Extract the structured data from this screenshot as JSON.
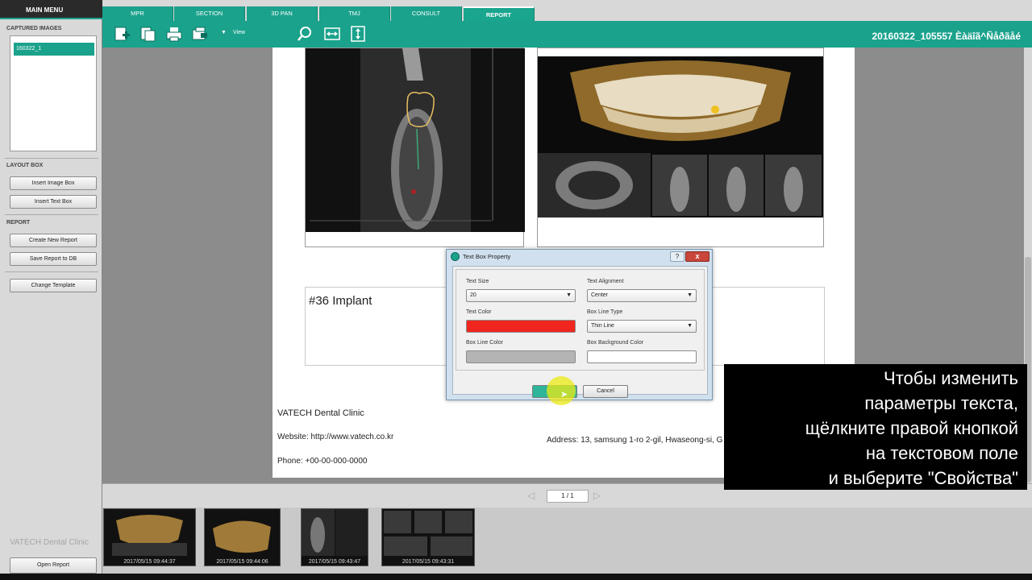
{
  "sidebar": {
    "main_menu": "MAIN MENU",
    "captured_title": "CAPTURED IMAGES",
    "captured_items": [
      "160322_1"
    ],
    "layout_title": "LAYOUT BOX",
    "insert_image_box": "Insert Image Box",
    "insert_text_box": "Insert Text Box",
    "report_title": "REPORT",
    "create_new_report": "Create New Report",
    "save_report": "Save Report to DB",
    "change_template": "Change Template",
    "watermark": "VATECH Dental Clinic",
    "open_report": "Open Report"
  },
  "tabs": [
    {
      "label": "MPR"
    },
    {
      "label": "SECTION"
    },
    {
      "label": "3D PAN"
    },
    {
      "label": "TMJ"
    },
    {
      "label": "CONSULT"
    },
    {
      "label": "REPORT"
    }
  ],
  "toolbar": {
    "view_label": "View",
    "study_title": "20160322_105557 Èàäîã^Ñåðãåé",
    "icons": [
      "add-page-icon",
      "copy-page-icon",
      "print-icon",
      "export-icon",
      "zoom-icon",
      "fit-width-icon",
      "fit-height-icon"
    ]
  },
  "report": {
    "textbox_text": "#36 Implant",
    "clinic_name": "VATECH Dental Clinic",
    "clinic_website": "Website: http://www.vatech.co.kr",
    "clinic_phone": "Phone: +00-00-000-0000",
    "clinic_address": "Address: 13, samsung 1-ro 2-gil, Hwaseong-si, G"
  },
  "dialog": {
    "title": "Text Box Property",
    "help": "?",
    "close": "x",
    "text_size_label": "Text Size",
    "text_size_value": "20",
    "text_alignment_label": "Text Alignment",
    "text_alignment_value": "Center",
    "text_color_label": "Text Color",
    "text_color": "#f0261e",
    "box_line_type_label": "Box Line Type",
    "box_line_type_value": "Thin Line",
    "box_line_color_label": "Box Line Color",
    "box_line_color": "#b4b4b4",
    "box_bg_color_label": "Box Background Color",
    "box_bg_color": "#ffffff",
    "ok_label": "OK",
    "cancel_label": "Cancel"
  },
  "pager": {
    "value": "1 / 1"
  },
  "thumbnails": [
    {
      "label": "2017/05/15 09:44:37"
    },
    {
      "label": "2017/05/15 09:44:06"
    },
    {
      "label": "2017/05/15 09:43:47"
    },
    {
      "label": "2017/05/15 09:43:31"
    }
  ],
  "subtitle": {
    "lines": [
      "Чтобы изменить",
      "параметры текста,",
      "щёлкните правой кнопкой",
      "на текстовом поле",
      "и выберите \"Свойства\""
    ]
  },
  "colors": {
    "accent": "#1aa28c",
    "highlight": "#ebeb14"
  }
}
